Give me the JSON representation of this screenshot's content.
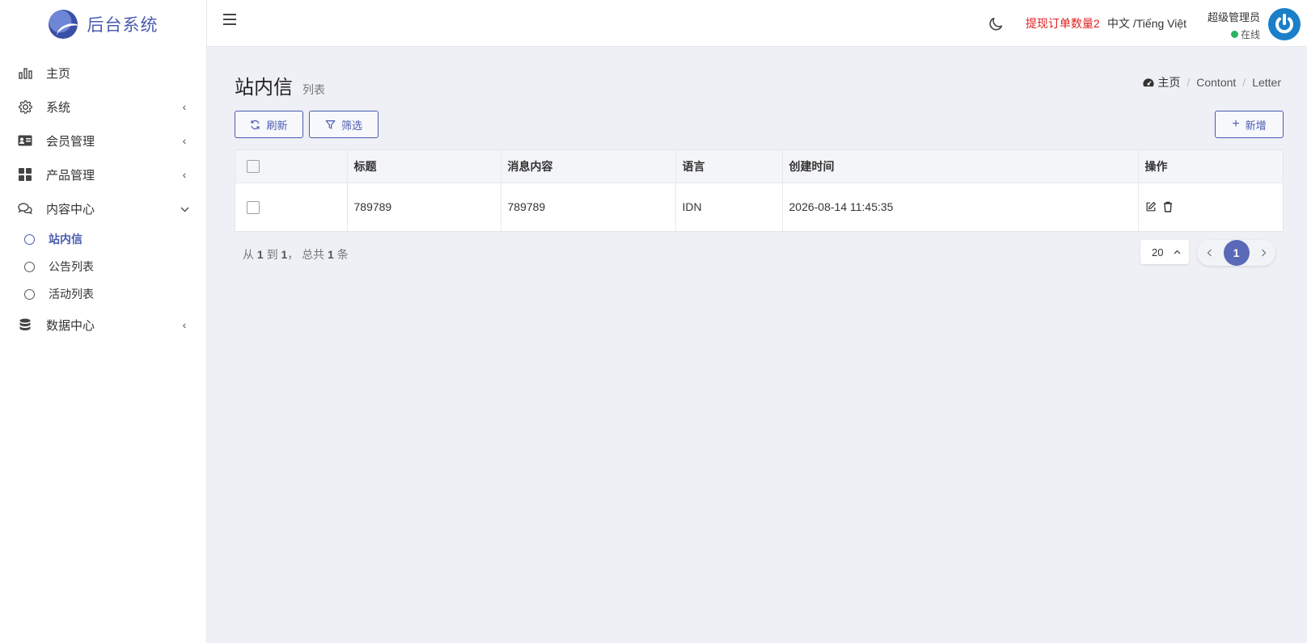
{
  "app": {
    "brand": "后台系统"
  },
  "sidebar": {
    "items": [
      {
        "label": "主页",
        "icon": "bar-chart-icon"
      },
      {
        "label": "系统",
        "icon": "gear-icon"
      },
      {
        "label": "会员管理",
        "icon": "id-card-icon"
      },
      {
        "label": "产品管理",
        "icon": "grid-icon"
      },
      {
        "label": "内容中心",
        "icon": "chat-icon"
      },
      {
        "label": "数据中心",
        "icon": "database-icon"
      }
    ],
    "content_sub": [
      {
        "label": "站内信",
        "active": true
      },
      {
        "label": "公告列表"
      },
      {
        "label": "活动列表"
      }
    ]
  },
  "header": {
    "alert": "提现订单数量2",
    "lang": "中文 /Tiếng Việt",
    "user_name": "超级管理员",
    "user_status": "在线"
  },
  "page": {
    "title": "站内信",
    "subtitle": "列表",
    "breadcrumb": [
      "主页",
      "Contont",
      "Letter"
    ]
  },
  "toolbar": {
    "refresh": "刷新",
    "filter": "筛选",
    "add": "新增"
  },
  "table": {
    "columns": [
      "标题",
      "消息内容",
      "语言",
      "创建时间",
      "操作"
    ],
    "rows": [
      {
        "title": "789789",
        "content": "789789",
        "lang": "IDN",
        "created": "2026-08-14 11:45:35"
      }
    ]
  },
  "pager": {
    "prefix": "从",
    "from": "1",
    "to_label": "到",
    "to": "1",
    "total_label": "， 总共",
    "total": "1",
    "suffix": "条",
    "page_size": "20",
    "current_page": "1"
  },
  "colors": {
    "accent": "#4a5bb0",
    "alert": "#e02020",
    "online": "#28b463"
  }
}
